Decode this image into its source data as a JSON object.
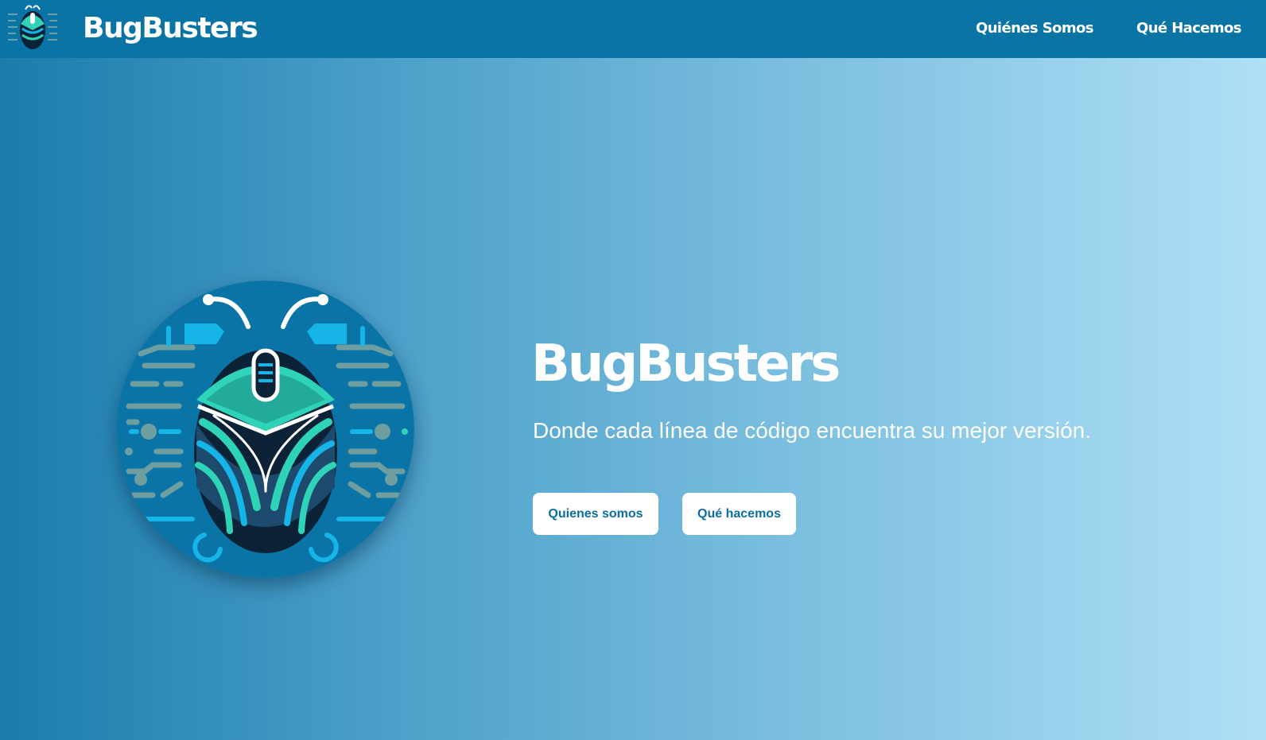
{
  "header": {
    "brand": "BugBusters",
    "logo_icon": "beetle-circuit-logo-icon",
    "nav": [
      {
        "label": "Quiénes Somos"
      },
      {
        "label": "Qué Hacemos"
      }
    ]
  },
  "hero": {
    "logo_icon": "beetle-circuit-logo-icon",
    "title": "BugBusters",
    "subtitle": "Donde cada línea de código encuentra su mejor versión.",
    "buttons": [
      {
        "label": "Quienes somos"
      },
      {
        "label": "Qué hacemos"
      }
    ]
  },
  "colors": {
    "header_bg": "#0a74a5",
    "gradient_start": "#1b7cad",
    "gradient_end": "#aee0f6",
    "button_text": "#0b6e9f",
    "logo_accent_teal": "#2ed3b8",
    "logo_accent_cyan": "#16b5e8"
  }
}
